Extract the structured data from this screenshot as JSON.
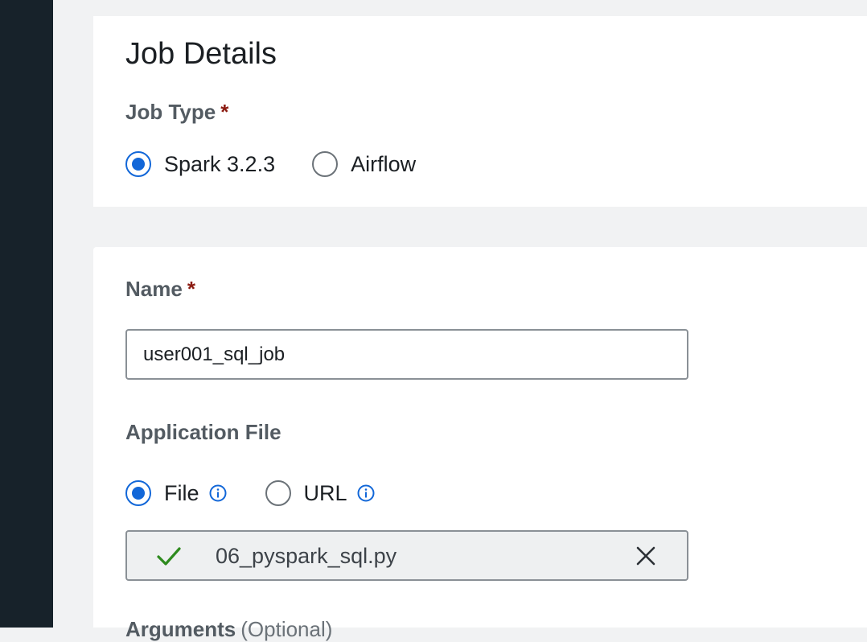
{
  "job_card": {
    "title": "Job Details",
    "job_type_label": "Job Type",
    "required_marker": "*",
    "job_type_options": [
      {
        "label": "Spark 3.2.3",
        "selected": true
      },
      {
        "label": "Airflow",
        "selected": false
      }
    ]
  },
  "details_card": {
    "name_label": "Name",
    "required_marker": "*",
    "name_value": "user001_sql_job",
    "application_file_label": "Application File",
    "source_options": [
      {
        "label": "File",
        "selected": true,
        "icon": "info-icon"
      },
      {
        "label": "URL",
        "selected": false,
        "icon": "info-icon"
      }
    ],
    "uploaded_file": {
      "name": "06_pyspark_sql.py",
      "status_icon": "check-icon",
      "remove_icon": "close-icon"
    },
    "next_field_label": "Arguments",
    "next_field_optional": "(Optional)"
  },
  "colors": {
    "sidebar": "#17222a",
    "accent": "#1267d8",
    "required": "#8b1a10",
    "success": "#2e8b1e"
  }
}
